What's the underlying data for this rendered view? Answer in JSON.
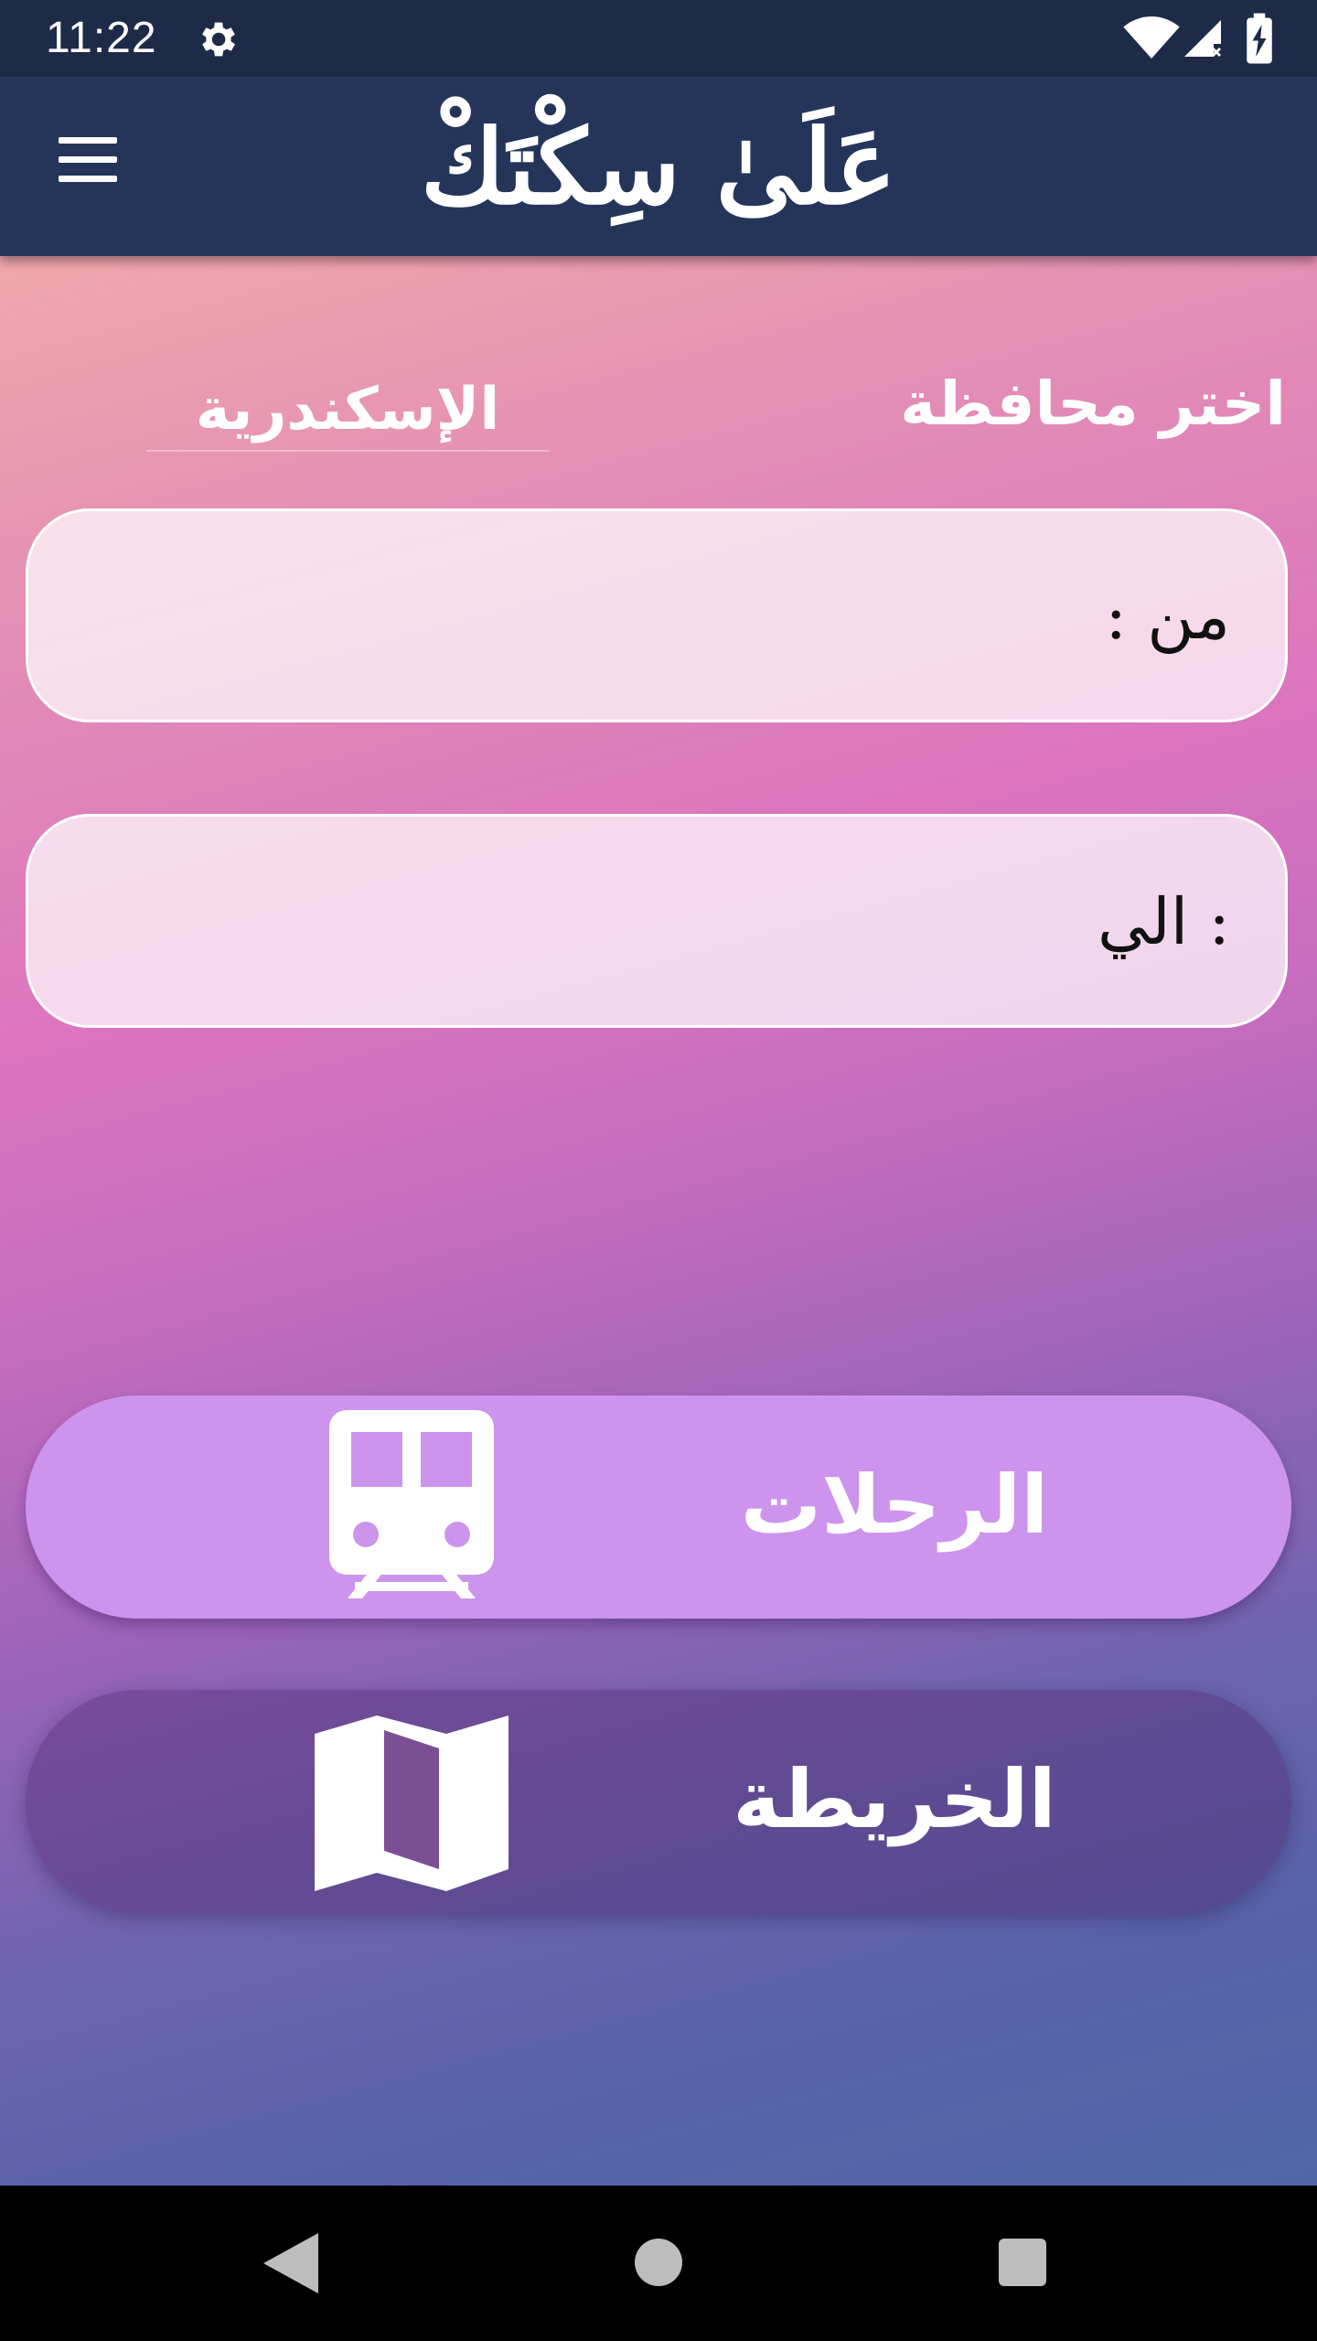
{
  "status_bar": {
    "time": "11:22",
    "icons": [
      "gear-icon",
      "wifi-icon",
      "signal-icon",
      "battery-charging-icon"
    ]
  },
  "app_bar": {
    "title": "عَلَىٰ سِكْتَكْ",
    "menu_icon": "hamburger-menu-icon"
  },
  "province": {
    "label": "اختر محافظة",
    "selected": "الإسكندرية"
  },
  "fields": {
    "from_label": "من :",
    "to_label": ": الي",
    "from_value": "",
    "to_value": ""
  },
  "buttons": {
    "trips_label": "الرحلات",
    "trips_icon": "train-icon",
    "map_label": "الخريطة",
    "map_icon": "map-icon"
  },
  "colors": {
    "app_bar": "#25355a",
    "trips_button": "#cc94ec",
    "gradient_top": "#f0a7ab",
    "gradient_bottom": "#4f66a6"
  },
  "nav_bar": {
    "icons": [
      "back-icon",
      "home-icon",
      "recent-apps-icon"
    ]
  }
}
